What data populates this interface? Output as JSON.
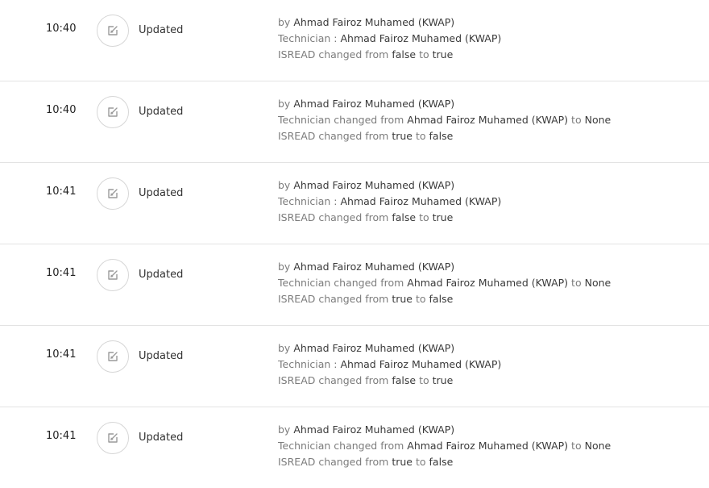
{
  "icon": "edit-icon",
  "text": {
    "by": "by",
    "technician_colon": "Technician :",
    "technician_changed_from": "Technician changed from",
    "isread_changed_from": "ISREAD changed from",
    "to": "to",
    "none": "None",
    "true": "true",
    "false": "false"
  },
  "entries": [
    {
      "time": "10:40",
      "action": "Updated",
      "user": "Ahmad Fairoz Muhamed (KWAP)",
      "technician": "Ahmad Fairoz Muhamed (KWAP)",
      "kind": "set",
      "isread_from": "false",
      "isread_to": "true"
    },
    {
      "time": "10:40",
      "action": "Updated",
      "user": "Ahmad Fairoz Muhamed (KWAP)",
      "technician": "Ahmad Fairoz Muhamed (KWAP)",
      "kind": "unset",
      "isread_from": "true",
      "isread_to": "false"
    },
    {
      "time": "10:41",
      "action": "Updated",
      "user": "Ahmad Fairoz Muhamed (KWAP)",
      "technician": "Ahmad Fairoz Muhamed (KWAP)",
      "kind": "set",
      "isread_from": "false",
      "isread_to": "true"
    },
    {
      "time": "10:41",
      "action": "Updated",
      "user": "Ahmad Fairoz Muhamed (KWAP)",
      "technician": "Ahmad Fairoz Muhamed (KWAP)",
      "kind": "unset",
      "isread_from": "true",
      "isread_to": "false"
    },
    {
      "time": "10:41",
      "action": "Updated",
      "user": "Ahmad Fairoz Muhamed (KWAP)",
      "technician": "Ahmad Fairoz Muhamed (KWAP)",
      "kind": "set",
      "isread_from": "false",
      "isread_to": "true"
    },
    {
      "time": "10:41",
      "action": "Updated",
      "user": "Ahmad Fairoz Muhamed (KWAP)",
      "technician": "Ahmad Fairoz Muhamed (KWAP)",
      "kind": "unset",
      "isread_from": "true",
      "isread_to": "false"
    }
  ]
}
